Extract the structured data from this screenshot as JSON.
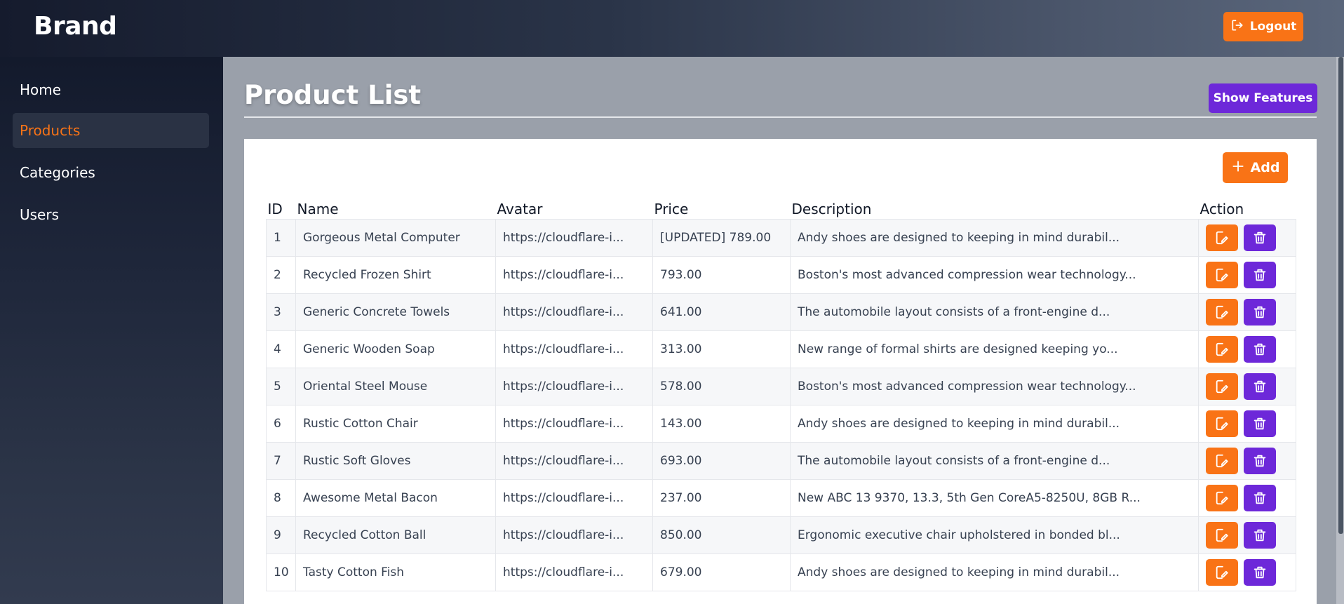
{
  "header": {
    "brand": "Brand",
    "logout_label": "Logout"
  },
  "sidebar": {
    "items": [
      {
        "label": "Home",
        "active": false
      },
      {
        "label": "Products",
        "active": true
      },
      {
        "label": "Categories",
        "active": false
      },
      {
        "label": "Users",
        "active": false
      }
    ]
  },
  "main": {
    "title": "Product List",
    "features_label": "Show Features",
    "add_label": "Add"
  },
  "table": {
    "columns": [
      "ID",
      "Name",
      "Avatar",
      "Price",
      "Description",
      "Action"
    ],
    "rows": [
      {
        "id": "1",
        "name": "Gorgeous Metal Computer",
        "avatar": "https://cloudflare-i...",
        "price": "[UPDATED] 789.00",
        "description": "Andy shoes are designed to keeping in mind durabil..."
      },
      {
        "id": "2",
        "name": "Recycled Frozen Shirt",
        "avatar": "https://cloudflare-i...",
        "price": "793.00",
        "description": "Boston's most advanced compression wear technology..."
      },
      {
        "id": "3",
        "name": "Generic Concrete Towels",
        "avatar": "https://cloudflare-i...",
        "price": "641.00",
        "description": "The automobile layout consists of a front-engine d..."
      },
      {
        "id": "4",
        "name": "Generic Wooden Soap",
        "avatar": "https://cloudflare-i...",
        "price": "313.00",
        "description": "New range of formal shirts are designed keeping yo..."
      },
      {
        "id": "5",
        "name": "Oriental Steel Mouse",
        "avatar": "https://cloudflare-i...",
        "price": "578.00",
        "description": "Boston's most advanced compression wear technology..."
      },
      {
        "id": "6",
        "name": "Rustic Cotton Chair",
        "avatar": "https://cloudflare-i...",
        "price": "143.00",
        "description": "Andy shoes are designed to keeping in mind durabil..."
      },
      {
        "id": "7",
        "name": "Rustic Soft Gloves",
        "avatar": "https://cloudflare-i...",
        "price": "693.00",
        "description": "The automobile layout consists of a front-engine d..."
      },
      {
        "id": "8",
        "name": "Awesome Metal Bacon",
        "avatar": "https://cloudflare-i...",
        "price": "237.00",
        "description": "New ABC 13 9370, 13.3, 5th Gen CoreA5-8250U, 8GB R..."
      },
      {
        "id": "9",
        "name": "Recycled Cotton Ball",
        "avatar": "https://cloudflare-i...",
        "price": "850.00",
        "description": "Ergonomic executive chair upholstered in bonded bl..."
      },
      {
        "id": "10",
        "name": "Tasty Cotton Fish",
        "avatar": "https://cloudflare-i...",
        "price": "679.00",
        "description": "Andy shoes are designed to keeping in mind durabil..."
      }
    ]
  },
  "icons": {
    "logout": "logout-icon",
    "add": "plus-icon",
    "edit": "edit-icon",
    "delete": "trash-icon"
  },
  "colors": {
    "accent_orange": "#f97316",
    "accent_purple": "#6d28d9",
    "content_bg": "#9aa0aa",
    "header_dark": "#151b2d"
  }
}
